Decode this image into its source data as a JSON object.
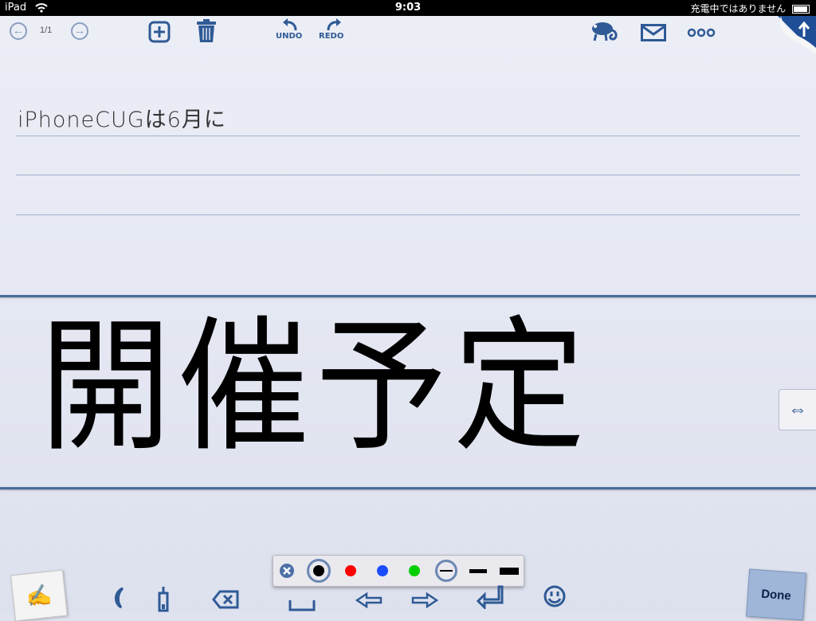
{
  "status_bar": {
    "device": "iPad",
    "time": "9:03",
    "battery_text": "充電中ではありません"
  },
  "toolbar": {
    "page_count": "1/1",
    "undo_label": "UNDO",
    "redo_label": "REDO",
    "icons": [
      "back-arrow-icon",
      "forward-arrow-icon",
      "add-icon",
      "trash-icon",
      "undo-icon",
      "redo-icon",
      "chameleon-icon",
      "mail-icon",
      "more-icon",
      "upload-icon"
    ]
  },
  "note": {
    "typed_line": "iPhoneCUGは6月に",
    "handwriting": "開催予定"
  },
  "palette": {
    "colors": {
      "black": "#000000",
      "red": "#ff0000",
      "blue": "#1a4cff",
      "green": "#00d000"
    },
    "selected": "black"
  },
  "bottom_bar": {
    "done_label": "Done",
    "icons": [
      "notepad-icon",
      "moon-icon",
      "pen-icon",
      "backspace-icon",
      "space-icon",
      "left-arrow-icon",
      "right-arrow-icon",
      "return-icon",
      "smiley-icon"
    ]
  },
  "colors": {
    "accent": "#2f5a95",
    "rule": "#9fb1cc",
    "heavy_rule": "#4a6b9c"
  }
}
